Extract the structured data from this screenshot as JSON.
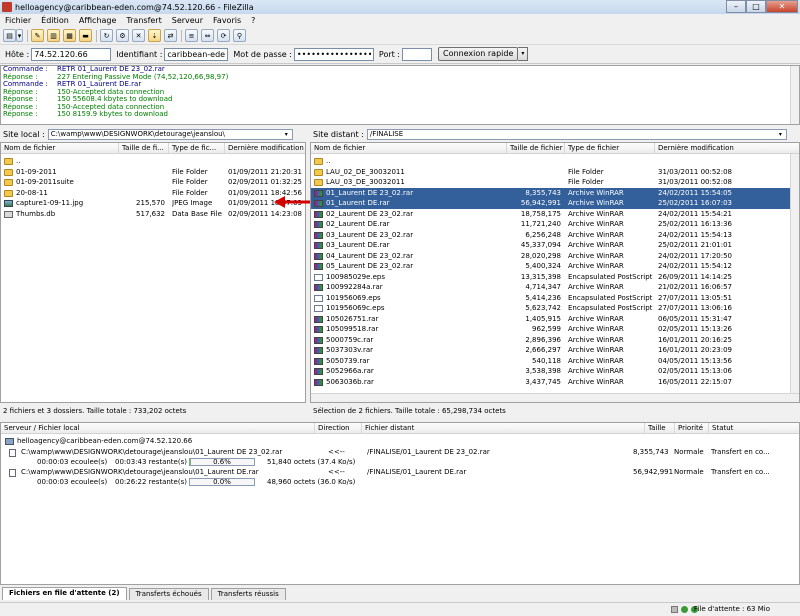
{
  "window": {
    "title": "helloagency@caribbean-eden.com@74.52.120.66 - FileZilla",
    "minimize": "–",
    "maximize": "□",
    "close": "✕"
  },
  "menu": [
    "Fichier",
    "Édition",
    "Affichage",
    "Transfert",
    "Serveur",
    "Favoris",
    "?"
  ],
  "quickconnect": {
    "host_label": "Hôte :",
    "host_value": "74.52.120.66",
    "user_label": "Identifiant :",
    "user_value": "caribbean-eden.com",
    "pass_label": "Mot de passe :",
    "pass_value": "••••••••••••••••",
    "port_label": "Port :",
    "port_value": "",
    "button": "Connexion rapide"
  },
  "log": [
    {
      "kind": "Commande :",
      "text": "RETR 01_Laurent DE 23_02.rar",
      "type": "cmd"
    },
    {
      "kind": "Réponse :",
      "text": "227 Entering Passive Mode (74,52,120,66,98,97)",
      "type": "ok"
    },
    {
      "kind": "Commande :",
      "text": "RETR 01_Laurent DE.rar",
      "type": "cmd"
    },
    {
      "kind": "Réponse :",
      "text": "150-Accepted data connection",
      "type": "ok"
    },
    {
      "kind": "Réponse :",
      "text": "150 55608.4 kbytes to download",
      "type": "ok"
    },
    {
      "kind": "Réponse :",
      "text": "150-Accepted data connection",
      "type": "ok"
    },
    {
      "kind": "Réponse :",
      "text": "150 8159.9 kbytes to download",
      "type": "ok"
    }
  ],
  "local": {
    "label": "Site local :",
    "path": "C:\\wamp\\www\\DESIGNWORK\\detourage\\jeanslou\\",
    "headers": {
      "name": "Nom de fichier",
      "size": "Taille de fi...",
      "type": "Type de fic...",
      "date": "Dernière modification"
    },
    "files": [
      {
        "name": "..",
        "size": "",
        "type": "",
        "date": "",
        "icon": "folder"
      },
      {
        "name": "01-09-2011",
        "size": "",
        "type": "File Folder",
        "date": "01/09/2011 21:20:31",
        "icon": "folder"
      },
      {
        "name": "01-09-2011suite",
        "size": "",
        "type": "File Folder",
        "date": "02/09/2011 01:32:25",
        "icon": "folder"
      },
      {
        "name": "20-08-11",
        "size": "",
        "type": "File Folder",
        "date": "01/09/2011 18:42:56",
        "icon": "folder"
      },
      {
        "name": "capture1-09-11.jpg",
        "size": "215,570",
        "type": "JPEG Image",
        "date": "01/09/2011 18:57:03",
        "icon": "img"
      },
      {
        "name": "Thumbs.db",
        "size": "517,632",
        "type": "Data Base File",
        "date": "02/09/2011 14:23:08",
        "icon": "db"
      }
    ],
    "status": "2 fichiers et 3 dossiers. Taille totale : 733,202 octets"
  },
  "remote": {
    "label": "Site distant :",
    "path": "/FINALISE",
    "headers": {
      "name": "Nom de fichier",
      "size": "Taille de fichier",
      "type": "Type de fichier",
      "date": "Dernière modification"
    },
    "files": [
      {
        "name": "..",
        "size": "",
        "type": "",
        "date": "",
        "icon": "folder"
      },
      {
        "name": "LAU_02_DE_30032011",
        "size": "",
        "type": "File Folder",
        "date": "31/03/2011 00:52:08",
        "icon": "folder"
      },
      {
        "name": "LAU_03_DE_30032011",
        "size": "",
        "type": "File Folder",
        "date": "31/03/2011 00:52:08",
        "icon": "folder"
      },
      {
        "name": "01_Laurent DE 23_02.rar",
        "size": "8,355,743",
        "type": "Archive WinRAR",
        "date": "24/02/2011 15:54:05",
        "icon": "rar",
        "selected": true
      },
      {
        "name": "01_Laurent DE.rar",
        "size": "56,942,991",
        "type": "Archive WinRAR",
        "date": "25/02/2011 16:07:03",
        "icon": "rar",
        "selected": true
      },
      {
        "name": "02_Laurent DE 23_02.rar",
        "size": "18,758,175",
        "type": "Archive WinRAR",
        "date": "24/02/2011 15:54:21",
        "icon": "rar"
      },
      {
        "name": "02_Laurent DE.rar",
        "size": "11,721,240",
        "type": "Archive WinRAR",
        "date": "25/02/2011 16:13:36",
        "icon": "rar"
      },
      {
        "name": "03_Laurent DE 23_02.rar",
        "size": "6,256,248",
        "type": "Archive WinRAR",
        "date": "24/02/2011 15:54:13",
        "icon": "rar"
      },
      {
        "name": "03_Laurent DE.rar",
        "size": "45,337,094",
        "type": "Archive WinRAR",
        "date": "25/02/2011 21:01:01",
        "icon": "rar"
      },
      {
        "name": "04_Laurent DE 23_02.rar",
        "size": "28,020,298",
        "type": "Archive WinRAR",
        "date": "24/02/2011 17:20:50",
        "icon": "rar"
      },
      {
        "name": "05_Laurent DE 23_02.rar",
        "size": "5,400,324",
        "type": "Archive WinRAR",
        "date": "24/02/2011 15:54:12",
        "icon": "rar"
      },
      {
        "name": "100985029e.eps",
        "size": "13,315,398",
        "type": "Encapsulated PostScript",
        "date": "26/09/2011 14:14:25",
        "icon": "doc"
      },
      {
        "name": "100992284a.rar",
        "size": "4,714,347",
        "type": "Archive WinRAR",
        "date": "21/02/2011 16:06:57",
        "icon": "rar"
      },
      {
        "name": "101956069.eps",
        "size": "5,414,236",
        "type": "Encapsulated PostScript",
        "date": "27/07/2011 13:05:51",
        "icon": "doc"
      },
      {
        "name": "101956069c.eps",
        "size": "5,623,742",
        "type": "Encapsulated PostScript",
        "date": "27/07/2011 13:06:16",
        "icon": "doc"
      },
      {
        "name": "105026751.rar",
        "size": "1,405,915",
        "type": "Archive WinRAR",
        "date": "06/05/2011 15:31:47",
        "icon": "rar"
      },
      {
        "name": "105099518.rar",
        "size": "962,599",
        "type": "Archive WinRAR",
        "date": "02/05/2011 15:13:26",
        "icon": "rar"
      },
      {
        "name": "5000759c.rar",
        "size": "2,896,396",
        "type": "Archive WinRAR",
        "date": "16/01/2011 20:16:25",
        "icon": "rar"
      },
      {
        "name": "5037303v.rar",
        "size": "2,666,297",
        "type": "Archive WinRAR",
        "date": "16/01/2011 20:23:09",
        "icon": "rar"
      },
      {
        "name": "5050739.rar",
        "size": "540,118",
        "type": "Archive WinRAR",
        "date": "04/05/2011 15:13:56",
        "icon": "rar"
      },
      {
        "name": "5052966a.rar",
        "size": "3,538,398",
        "type": "Archive WinRAR",
        "date": "02/05/2011 15:13:06",
        "icon": "rar"
      },
      {
        "name": "5063036b.rar",
        "size": "3,437,745",
        "type": "Archive WinRAR",
        "date": "16/05/2011 22:15:07",
        "icon": "rar"
      }
    ],
    "status": "Sélection de 2 fichiers. Taille totale : 65,298,734 octets"
  },
  "queue": {
    "headers": {
      "server": "Serveur / Fichier local",
      "direction": "Direction",
      "remote": "Fichier distant",
      "size": "Taille",
      "priority": "Priorité",
      "status": "Statut"
    },
    "server": "helloagency@caribbean-eden.com@74.52.120.66",
    "items": [
      {
        "local": "C:\\wamp\\www\\DESIGNWORK\\detourage\\jeanslou\\01_Laurent DE 23_02.rar",
        "direction": "<<--",
        "remote": "/FINALISE/01_Laurent DE 23_02.rar",
        "size": "8,355,743",
        "priority": "Normale",
        "status": "Transfert en co...",
        "elapsed": "00:00:03 ecoulee(s)",
        "remaining": "00:03:43 restante(s)",
        "progress": "0.6%",
        "progress_value": 0.6,
        "speed": "51,840 octets (37.4 Ko/s)"
      },
      {
        "local": "C:\\wamp\\www\\DESIGNWORK\\detourage\\jeanslou\\01_Laurent DE.rar",
        "direction": "<<--",
        "remote": "/FINALISE/01_Laurent DE.rar",
        "size": "56,942,991",
        "priority": "Normale",
        "status": "Transfert en co...",
        "elapsed": "00:00:03 ecoulee(s)",
        "remaining": "00:26:22 restante(s)",
        "progress": "0.0%",
        "progress_value": 0.0,
        "speed": "48,960 octets (36.0 Ko/s)"
      }
    ]
  },
  "tabs": [
    "Fichiers en file d'attente (2)",
    "Transferts échoués",
    "Transferts réussis"
  ],
  "statusbar": {
    "queue": "File d'attente : 63 Mio"
  },
  "colors": {
    "selection": "#33609a",
    "log_command": "#000080",
    "log_response": "#008000",
    "arrow": "#d40000"
  }
}
